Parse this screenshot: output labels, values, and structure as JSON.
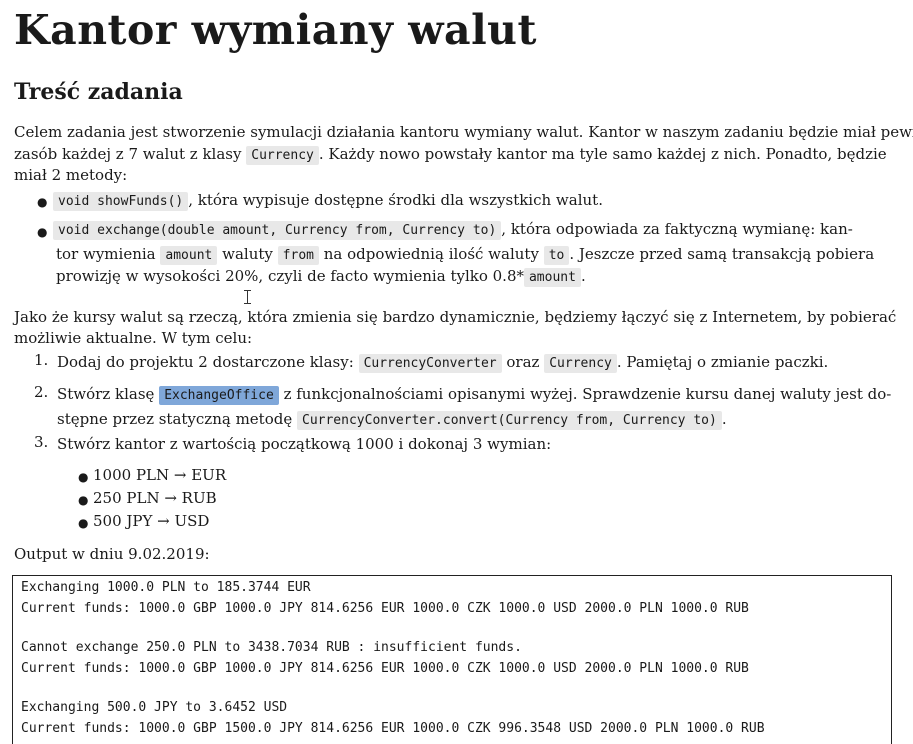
{
  "title": "Kantor wymiany walut",
  "section_title": "Treść zadania",
  "intro": {
    "line1_a": "Celem zadania jest stworzenie symulacji działania kantoru wymiany walut. Kantor w naszym zadaniu będzie miał pewien",
    "line2_a": "zasób każdej z 7 walut z klasy",
    "line2_code": "Currency",
    "line2_b": ". Każdy nowo powstały kantor ma tyle samo każdej z nich. Ponadto, będzie",
    "line3": "miał 2 metody:"
  },
  "methods": {
    "m1_code": "void showFunds()",
    "m1_text": ", która wypisuje dostępne środki dla wszystkich walut.",
    "m2_code": "void exchange(double amount, Currency from, Currency to)",
    "m2_text": ", która odpowiada za faktyczną wymianę: kan-",
    "m2_l2_a": "tor wymienia",
    "m2_l2_c1": "amount",
    "m2_l2_b": "waluty",
    "m2_l2_c2": "from",
    "m2_l2_c": "na odpowiednią ilość waluty",
    "m2_l2_c3": "to",
    "m2_l2_d": ". Jeszcze przed samą transakcją pobiera",
    "m2_l3_a": "prowizję w wysokości 20%, czyli de facto wymienia tylko 0.8*",
    "m2_l3_c": "amount",
    "m2_l3_b": "."
  },
  "para2": {
    "line1": "Jako że kursy walut są rzeczą, która zmienia się bardzo dynamicznie, będziemy łączyć się z Internetem, by pobierać",
    "line2": "możliwie aktualne. W tym celu:"
  },
  "steps": {
    "s1_num": "1.",
    "s1_a": "Dodaj do projektu 2 dostarczone klasy:",
    "s1_c1": "CurrencyConverter",
    "s1_b": "oraz",
    "s1_c2": "Currency",
    "s1_c": ". Pamiętaj o zmianie paczki.",
    "s2_num": "2.",
    "s2_a": "Stwórz klasę",
    "s2_c1": "ExchangeOffice",
    "s2_b": "z funkcjonalnościami opisanymi wyżej. Sprawdzenie kursu danej waluty jest do-",
    "s2_l2_a": "stępne przez statyczną metodę",
    "s2_l2_c": "CurrencyConverter.convert(Currency from, Currency to)",
    "s2_l2_b": ".",
    "s3_num": "3.",
    "s3_a": "Stwórz kantor z wartością początkową 1000 i dokonaj 3 wymian:",
    "sub": [
      "1000 PLN → EUR",
      "250 PLN → RUB",
      "500 JPY → USD"
    ]
  },
  "output_label": "Output w dniu 9.02.2019:",
  "output_lines": [
    "Exchanging 1000.0 PLN to 185.3744 EUR",
    "Current funds: 1000.0 GBP 1000.0 JPY 814.6256 EUR 1000.0 CZK 1000.0 USD 2000.0 PLN 1000.0 RUB",
    "Cannot exchange 250.0 PLN to 3438.7034 RUB : insufficient funds.",
    "Current funds: 1000.0 GBP 1000.0 JPY 814.6256 EUR 1000.0 CZK 1000.0 USD 2000.0 PLN 1000.0 RUB",
    "Exchanging 500.0 JPY to 3.6452 USD",
    "Current funds: 1000.0 GBP 1500.0 JPY 814.6256 EUR 1000.0 CZK 996.3548 USD 2000.0 PLN 1000.0 RUB"
  ]
}
